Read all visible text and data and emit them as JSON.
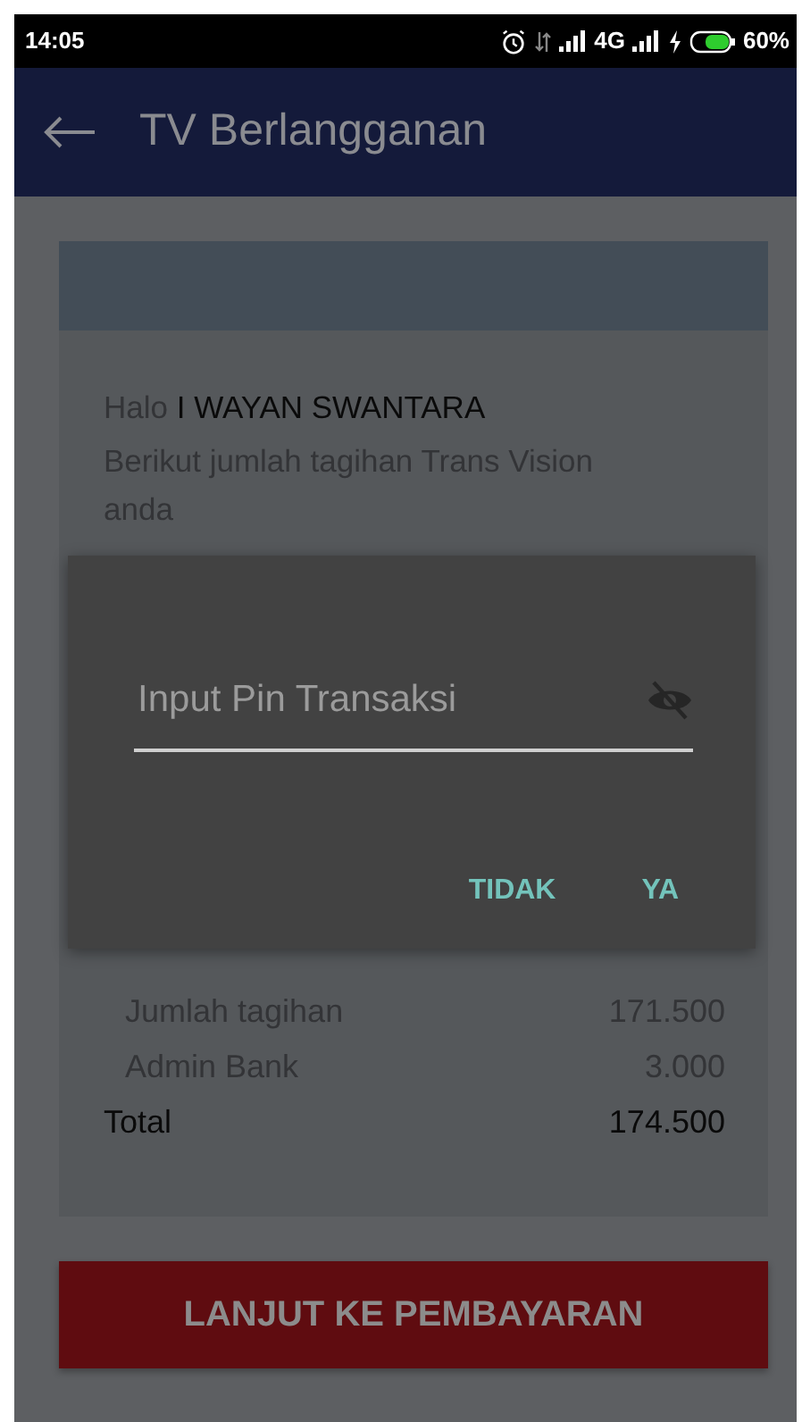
{
  "status_bar": {
    "time": "14:05",
    "network": "4G",
    "battery": "60%"
  },
  "app_bar": {
    "title": "TV Berlangganan"
  },
  "bill": {
    "greeting": "Halo",
    "customer_name": "I WAYAN SWANTARA",
    "message": "Berikut jumlah tagihan Trans Vision anda",
    "items": [
      {
        "label": "Jumlah tagihan",
        "amount": "171.500"
      },
      {
        "label": "Admin Bank",
        "amount": "3.000"
      }
    ],
    "total": {
      "label": "Total",
      "amount": "174.500"
    }
  },
  "dialog": {
    "placeholder": "Input Pin Transaksi",
    "password_visible": false,
    "buttons": [
      "TIDAK",
      "YA"
    ]
  },
  "pay_button": "LANJUT KE PEMBAYARAN"
}
